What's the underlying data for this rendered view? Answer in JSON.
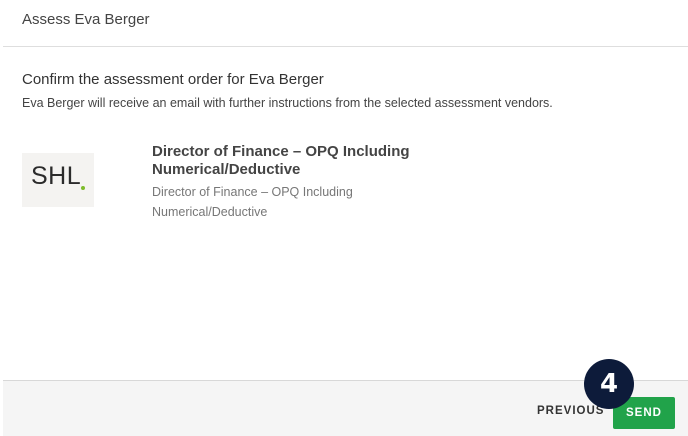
{
  "header": {
    "title": "Assess Eva Berger"
  },
  "main": {
    "title": "Confirm the assessment order for Eva Berger",
    "subtitle": "Eva Berger will receive an email with further instructions from the selected assessment vendors.",
    "item": {
      "vendor_logo_text": "SHL",
      "vendor_logo_icon": "shl-logo",
      "title": "Director of Finance – OPQ Including Numerical/Deductive",
      "description": "Director of Finance – OPQ Including Numerical/Deductive"
    }
  },
  "footer": {
    "previous_label": "PREVIOUS",
    "send_label": "SEND"
  },
  "step_badge": "4",
  "colors": {
    "send_button": "#21a34a",
    "badge": "#0d1b3a",
    "logo_dot": "#7dbb2b"
  }
}
